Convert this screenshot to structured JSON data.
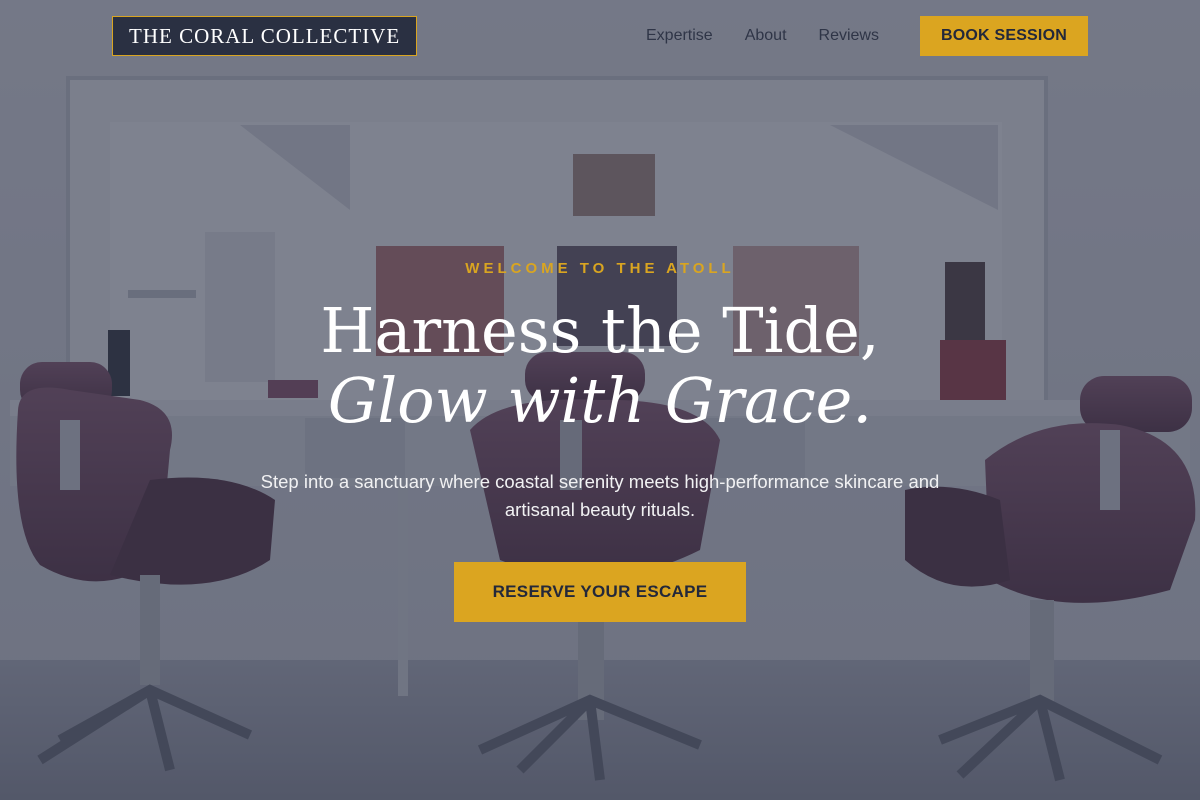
{
  "brand": {
    "name": "THE CORAL COLLECTIVE"
  },
  "nav": {
    "links": [
      {
        "label": "Expertise"
      },
      {
        "label": "About"
      },
      {
        "label": "Reviews"
      }
    ],
    "cta_label": "BOOK SESSION"
  },
  "hero": {
    "eyebrow": "WELCOME TO THE ATOLL",
    "headline_line1": "Harness the Tide,",
    "headline_line2": "Glow with Grace.",
    "subtext": "Step into a sanctuary where coastal serenity meets high-performance skincare and artisanal beauty rituals.",
    "cta_label": "RESERVE YOUR ESCAPE",
    "background": "salon interior with mirrors, framed portraits and mauve styling chairs"
  },
  "colors": {
    "accent": "#dba520",
    "overlay": "#22283c",
    "text_light": "#ffffff",
    "nav_text": "#2f3547",
    "chair": "#6d4a5e"
  }
}
